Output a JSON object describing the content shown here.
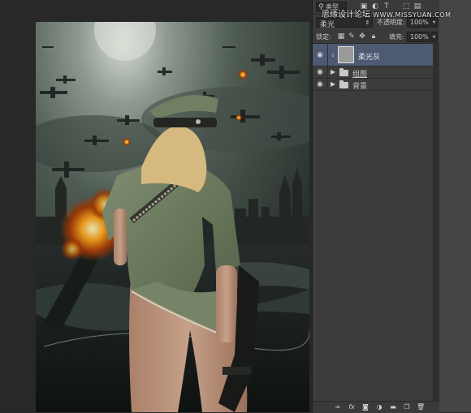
{
  "watermark": {
    "site_name": "思缘设计论坛",
    "site_url": "WWW.MISSYUAN.COM"
  },
  "filter_row": {
    "kind_label": "类型",
    "icons": [
      "search-icon",
      "image-filter-icon",
      "adjustment-filter-icon",
      "type-filter-icon",
      "shape-filter-icon",
      "smart-object-filter-icon"
    ]
  },
  "blend": {
    "mode": "柔光",
    "opacity_label": "不透明度:",
    "opacity_value": "100%"
  },
  "lock": {
    "label": "锁定:",
    "fill_label": "填充:",
    "fill_value": "100%"
  },
  "layers": [
    {
      "name": "柔光灰",
      "kind": "layer",
      "visible": true,
      "selected": true
    },
    {
      "name": "组图",
      "kind": "group",
      "visible": true,
      "selected": false
    },
    {
      "name": "背景",
      "kind": "group",
      "visible": true,
      "selected": false
    }
  ],
  "bottom_icons": [
    "link-layers-icon",
    "fx-icon",
    "add-mask-icon",
    "adjustment-layer-icon",
    "new-group-icon",
    "new-layer-icon",
    "delete-icon"
  ],
  "colors": {
    "panel": "#3c3c3c",
    "selected_row": "#4d5a72",
    "canvas_bg": "#282828"
  }
}
